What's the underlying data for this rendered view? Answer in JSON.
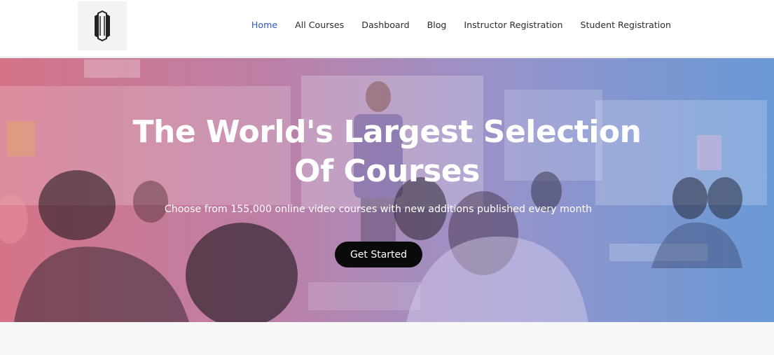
{
  "header": {
    "logo_icon": "brand-logo-icon",
    "nav": [
      {
        "label": "Home",
        "active": true
      },
      {
        "label": "All Courses",
        "active": false
      },
      {
        "label": "Dashboard",
        "active": false
      },
      {
        "label": "Blog",
        "active": false
      },
      {
        "label": "Instructor Registration",
        "active": false
      },
      {
        "label": "Student Registration",
        "active": false
      }
    ]
  },
  "hero": {
    "title": "The World's Largest Selection Of Courses",
    "subtitle": "Choose from 155,000 online video courses with new additions published every month",
    "cta_label": "Get Started",
    "gradient_colors": [
      "#cd5870",
      "#a8588c",
      "#736eb9",
      "#4682cd"
    ],
    "background_image": "classroom-photo"
  },
  "colors": {
    "nav_active": "#2f56c8",
    "nav_text": "#2c2c2c",
    "cta_bg": "#0a0a0a",
    "cta_text": "#ffffff"
  }
}
